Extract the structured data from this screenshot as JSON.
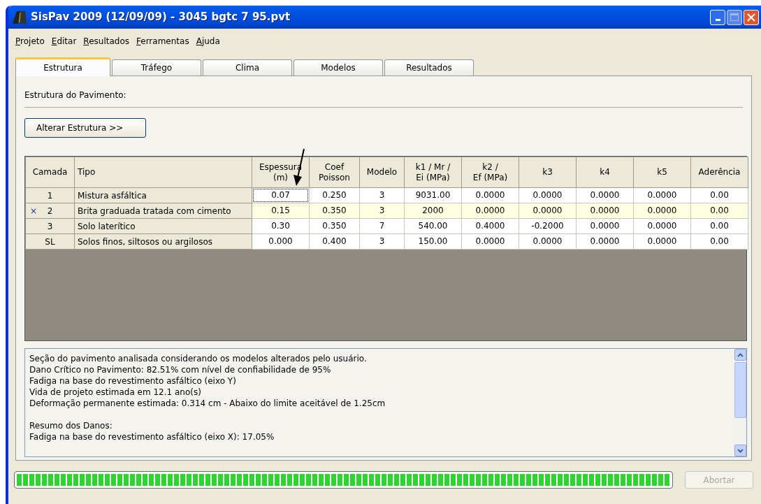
{
  "window": {
    "title": "SisPav 2009 (12/09/09) - 3045 bgtc 7 95.pvt"
  },
  "menu": [
    "Projeto",
    "Editar",
    "Resultados",
    "Ferramentas",
    "Ajuda"
  ],
  "tabs": [
    {
      "label": "Estrutura",
      "selected": true
    },
    {
      "label": "Tráfego",
      "selected": false
    },
    {
      "label": "Clima",
      "selected": false
    },
    {
      "label": "Modelos",
      "selected": false
    },
    {
      "label": "Resultados",
      "selected": false
    }
  ],
  "section_label": "Estrutura do Pavimento:",
  "alter_button": "Alterar Estrutura >>",
  "table": {
    "columns": [
      "Camada",
      "Tipo",
      "Espessura\n(m)",
      "Coef\nPoisson",
      "Modelo",
      "k1 / Mr /\nEi (MPa)",
      "k2 /\nEf (MPa)",
      "k3",
      "k4",
      "k5",
      "Aderência"
    ],
    "rows": [
      {
        "marker": null,
        "camada": "1",
        "tipo": "Mistura asfáltica",
        "selected": false,
        "values": [
          {
            "text": "0.07",
            "focused": true
          },
          {
            "text": "0.250",
            "focused": false
          },
          {
            "text": "3",
            "focused": false
          },
          {
            "text": "9031.00",
            "focused": false
          },
          {
            "text": "0.0000",
            "focused": false
          },
          {
            "text": "0.0000",
            "focused": false
          },
          {
            "text": "0.0000",
            "focused": false
          },
          {
            "text": "0.0000",
            "focused": false
          },
          {
            "text": "0.00",
            "focused": false
          }
        ]
      },
      {
        "marker": "×",
        "camada": "2",
        "tipo": "Brita graduada tratada com cimento",
        "selected": true,
        "values": [
          {
            "text": "0.15",
            "focused": false
          },
          {
            "text": "0.350",
            "focused": false
          },
          {
            "text": "3",
            "focused": false
          },
          {
            "text": "2000",
            "focused": false
          },
          {
            "text": "0.0000",
            "focused": false
          },
          {
            "text": "0.0000",
            "focused": false
          },
          {
            "text": "0.0000",
            "focused": false
          },
          {
            "text": "0.0000",
            "focused": false
          },
          {
            "text": "0.00",
            "focused": false
          }
        ]
      },
      {
        "marker": null,
        "camada": "3",
        "tipo": "Solo laterítico",
        "selected": false,
        "values": [
          {
            "text": "0.30",
            "focused": false
          },
          {
            "text": "0.350",
            "focused": false
          },
          {
            "text": "7",
            "focused": false
          },
          {
            "text": "540.00",
            "focused": false
          },
          {
            "text": "0.4000",
            "focused": false
          },
          {
            "text": "-0.2000",
            "focused": false
          },
          {
            "text": "0.0000",
            "focused": false
          },
          {
            "text": "0.0000",
            "focused": false
          },
          {
            "text": "0.00",
            "focused": false
          }
        ]
      },
      {
        "marker": null,
        "camada": "SL",
        "tipo": "Solos finos, siltosos ou argilosos",
        "selected": false,
        "values": [
          {
            "text": "0.000",
            "focused": false
          },
          {
            "text": "0.400",
            "focused": false
          },
          {
            "text": "3",
            "focused": false
          },
          {
            "text": "150.00",
            "focused": false
          },
          {
            "text": "0.0000",
            "focused": false
          },
          {
            "text": "0.0000",
            "focused": false
          },
          {
            "text": "0.0000",
            "focused": false
          },
          {
            "text": "0.0000",
            "focused": false
          },
          {
            "text": "0.00",
            "focused": false
          }
        ]
      }
    ]
  },
  "report": [
    [
      "Seção do pavimento analisada considerando os modelos alterados pelo usuário.",
      "Dano Crítico no Pavimento: 82.51% com nível de confiabilidade de 95%",
      "Fadiga na base do revestimento asfáltico (eixo Y)",
      "Vida de projeto estimada em 12.1 ano(s)",
      "Deformação permanente estimada: 0.314 cm - Abaixo do limite aceitável de 1.25cm"
    ],
    [
      "Resumo dos Danos:",
      "Fadiga na base do revestimento asfáltico (eixo X): 17.05%"
    ]
  ],
  "progress": {
    "level": 1
  },
  "abort_button": {
    "label": "Abortar",
    "disabled": true
  }
}
